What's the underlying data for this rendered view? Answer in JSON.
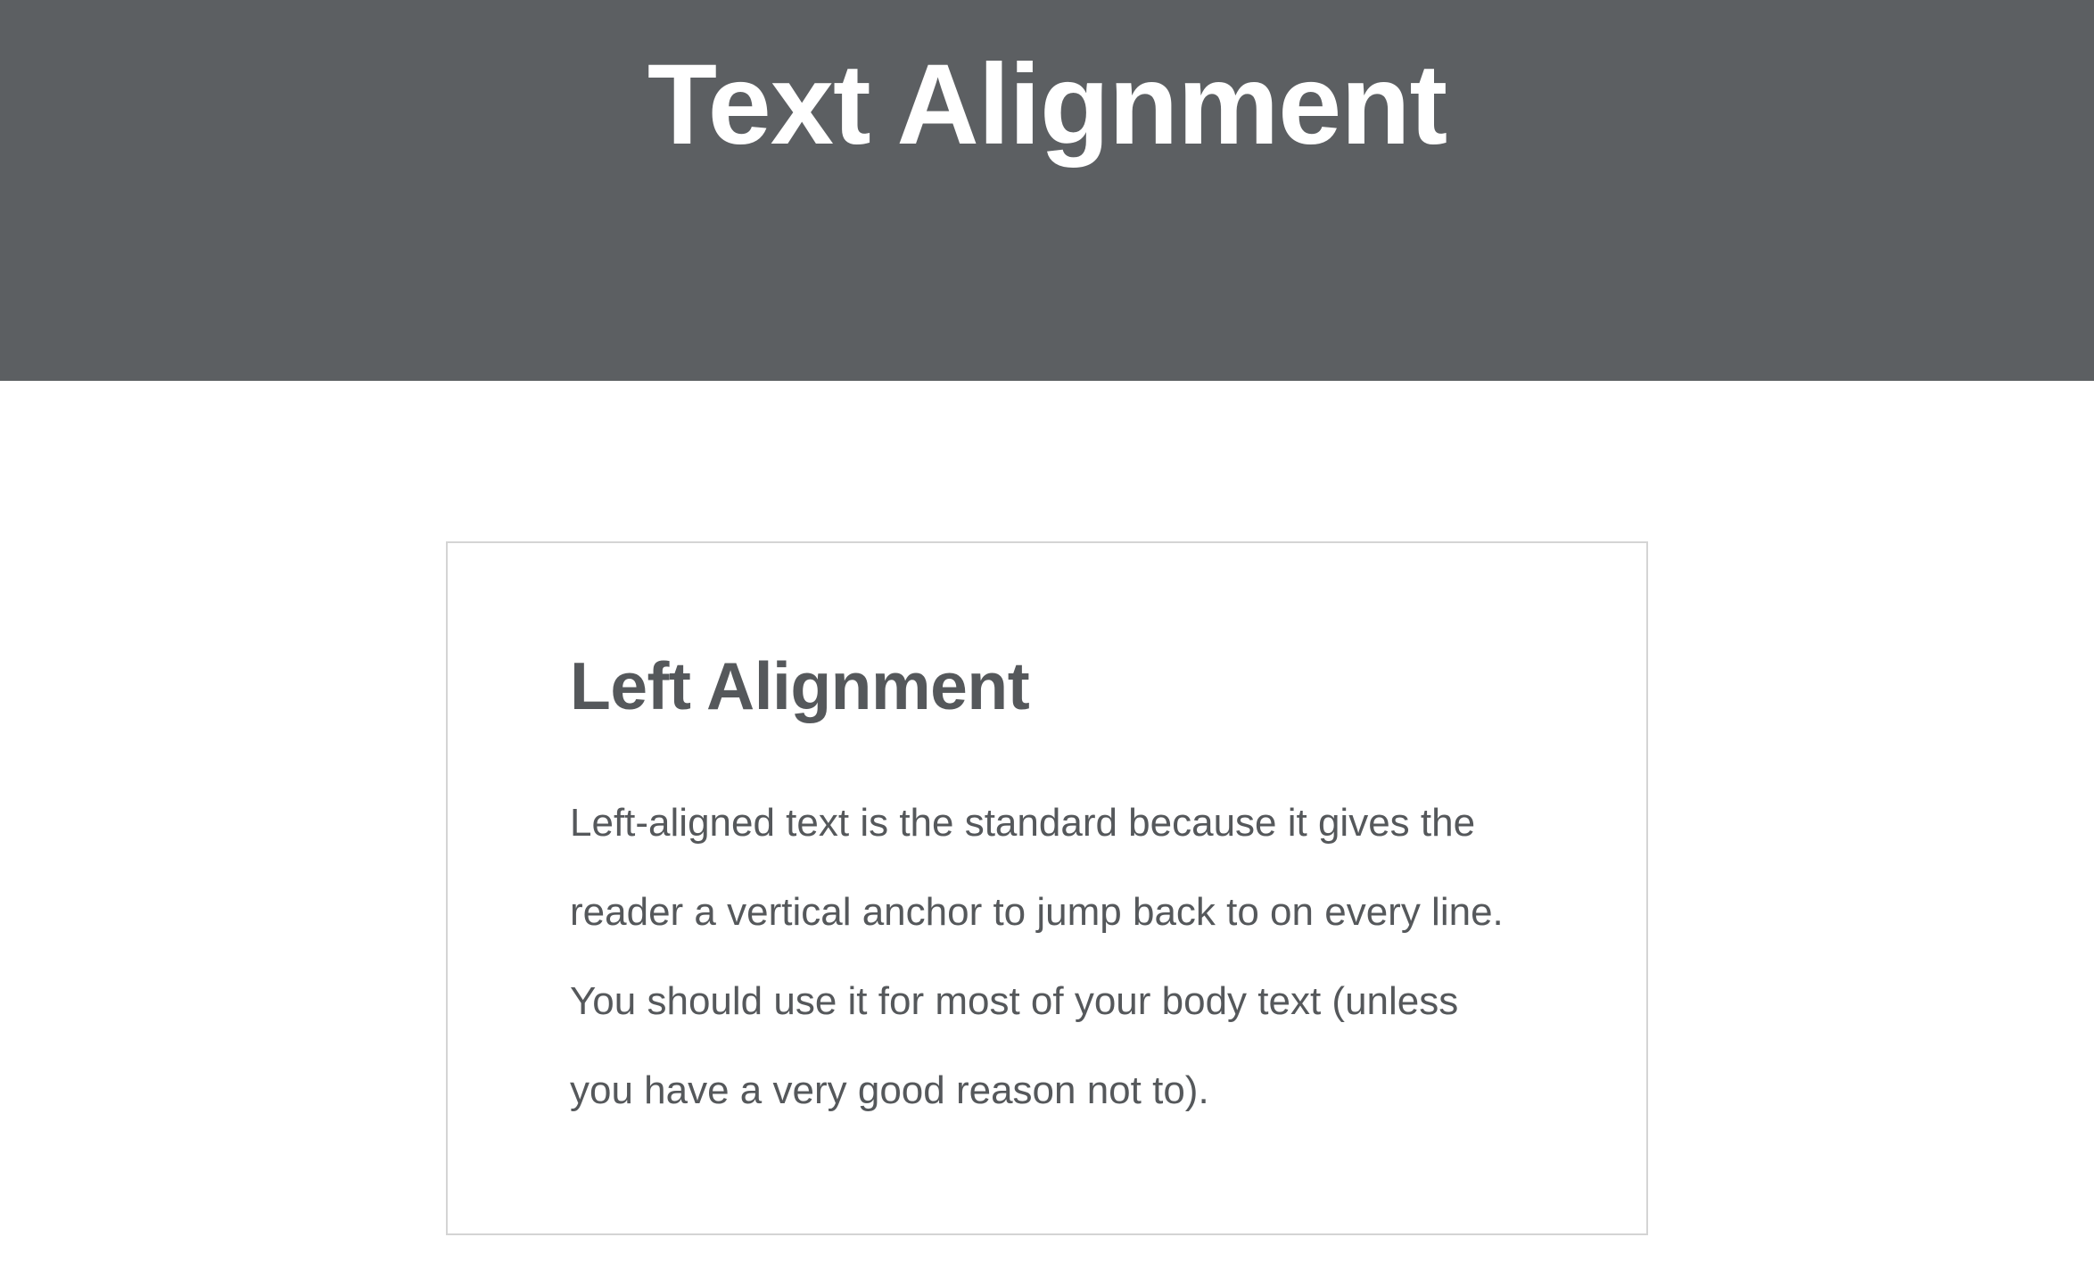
{
  "header": {
    "title": "Text Alignment",
    "background_color": "#5c5f62"
  },
  "card": {
    "heading": "Left Alignment",
    "body_lines": [
      "Left-aligned text is the standard because it gives the",
      "reader a vertical anchor to jump back to on every line.",
      "You should use it for most of your body text (unless",
      "you have a very good reason not to)."
    ],
    "text_color": "#55585b",
    "border_color": "#d4d4d4"
  }
}
